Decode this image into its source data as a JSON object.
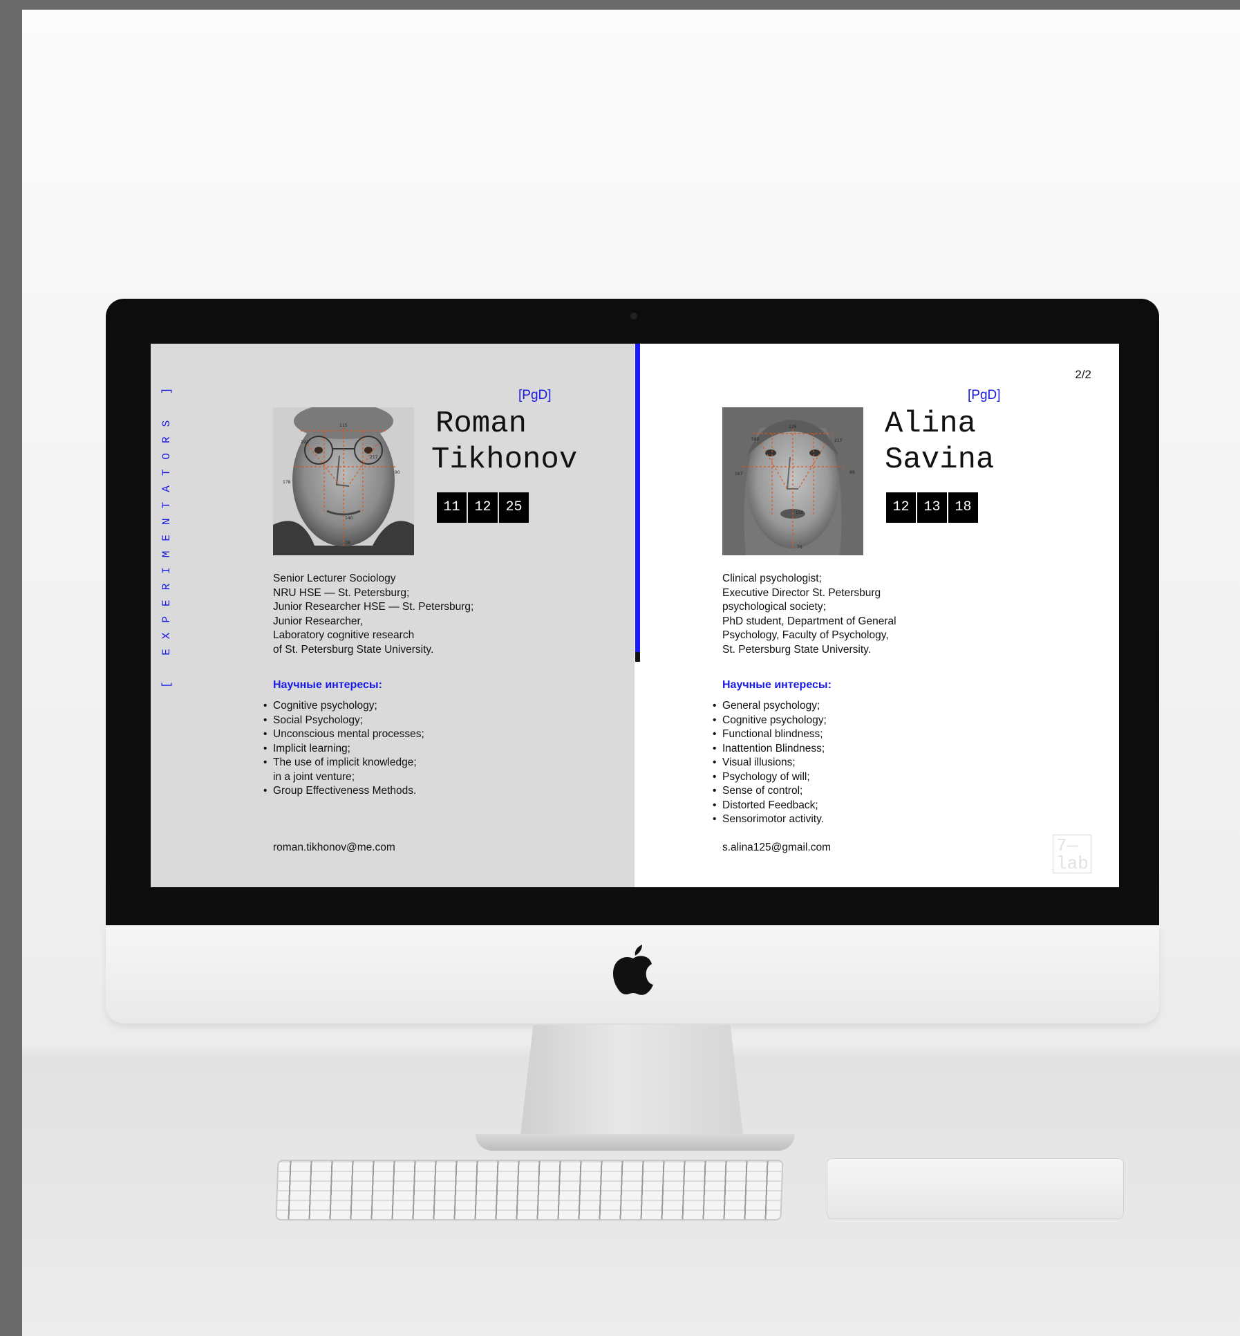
{
  "screen": {
    "side_label": "[ EXPERIMENTATORS ]",
    "page_number": "2/2",
    "lab_logo": "7— lab",
    "accent_color": "#1a1ae6"
  },
  "people": [
    {
      "tag": "[PgD]",
      "name_line1": "Roman",
      "name_line2": "Tikhonov",
      "codes": [
        "11",
        "12",
        "25"
      ],
      "photo_measurements": [
        "115",
        "192",
        "217",
        "178",
        "90",
        "140",
        "78"
      ],
      "bio": [
        "Senior Lecturer Sociology",
        "NRU HSE — St. Petersburg;",
        "Junior Researcher HSE — St. Petersburg;",
        "Junior Researcher,",
        "Laboratory cognitive research",
        "of St. Petersburg State University."
      ],
      "interests_title": "Научные интересы:",
      "interests": [
        "Cognitive psychology;",
        "Social Psychology;",
        "Unconscious mental processes;",
        "Implicit learning;",
        "The use of implicit knowledge;",
        "in a joint venture;",
        "Group Effectiveness Methods."
      ],
      "email": "roman.tikhonov@me.com"
    },
    {
      "tag": "[PgD]",
      "name_line1": "Alina",
      "name_line2": "Savina",
      "codes": [
        "12",
        "13",
        "18"
      ],
      "photo_measurements": [
        "126",
        "592",
        "217",
        "167",
        "89",
        "150",
        "76"
      ],
      "bio": [
        "Clinical psychologist;",
        "Executive Director St. Petersburg",
        "psychological society;",
        "PhD student, Department of General",
        "Psychology, Faculty of Psychology,",
        "St. Petersburg State University."
      ],
      "interests_title": "Научные интересы:",
      "interests": [
        "General psychology;",
        "Cognitive psychology;",
        "Functional blindness;",
        "Inattention Blindness;",
        "Visual illusions;",
        "Psychology of will;",
        "Sense of control;",
        "Distorted Feedback;",
        "Sensorimotor activity."
      ],
      "email": "s.alina125@gmail.com"
    }
  ]
}
